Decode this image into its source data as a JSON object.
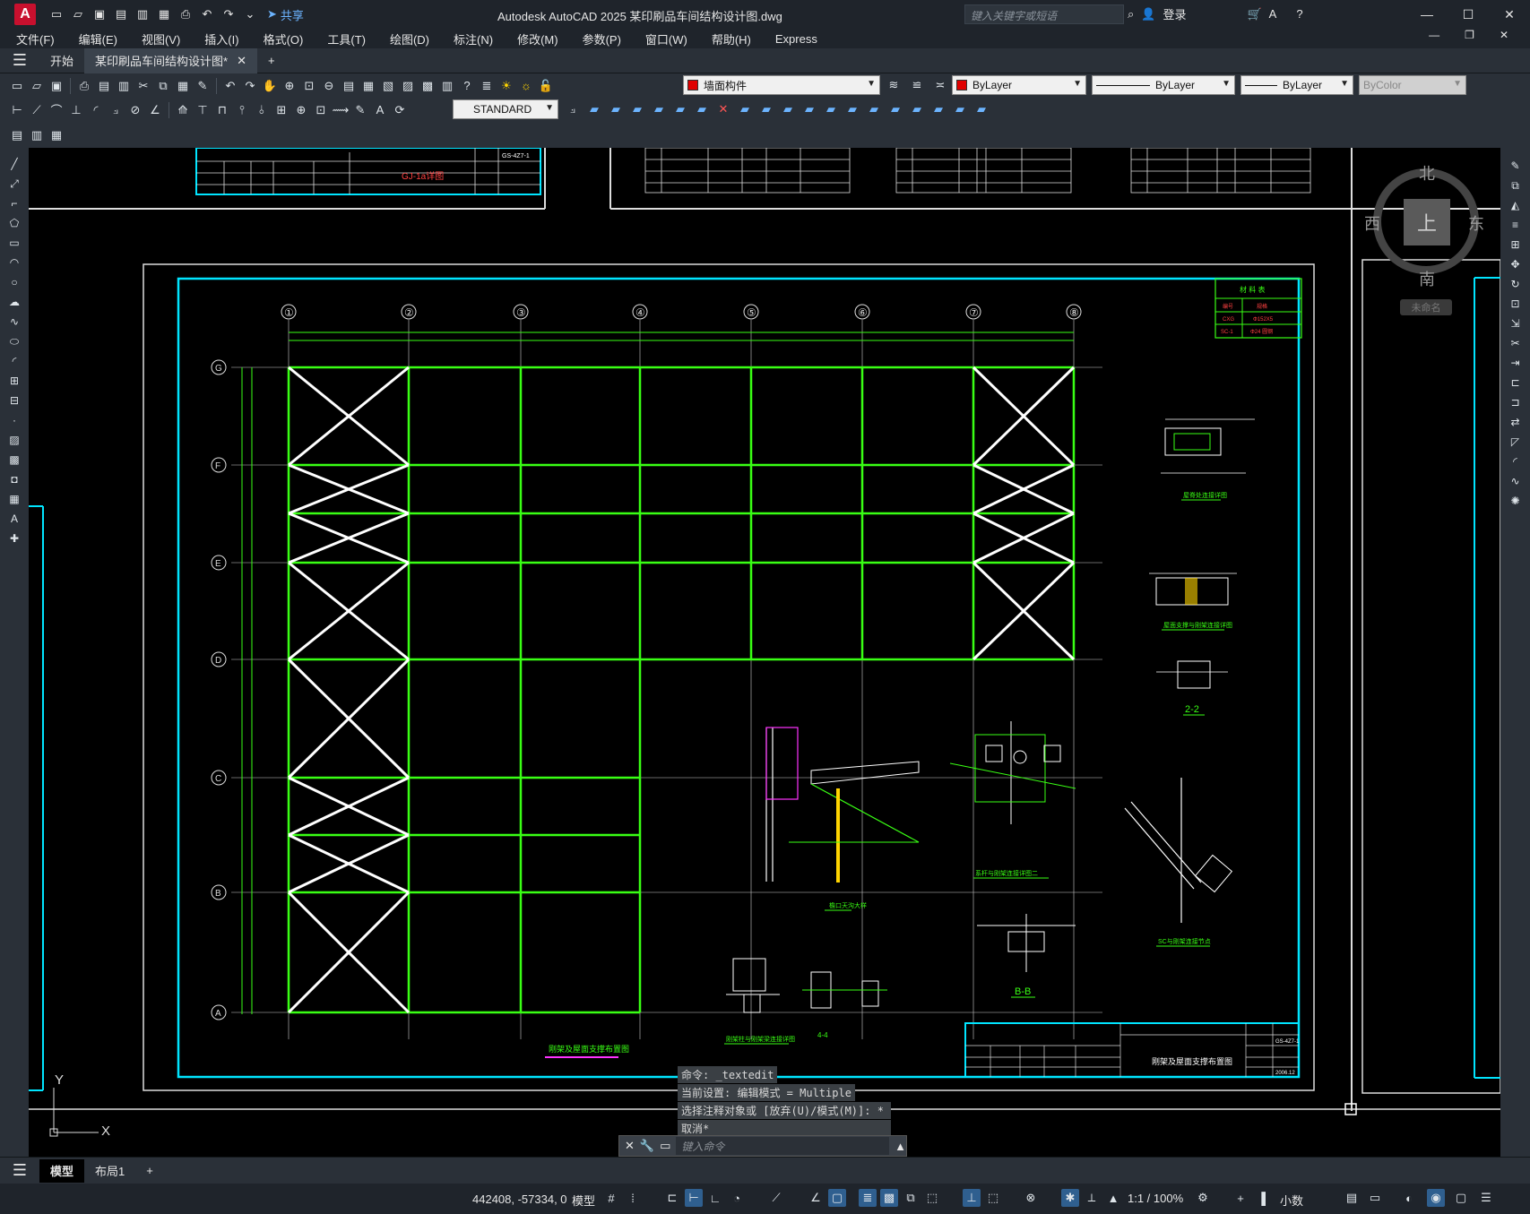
{
  "titlebar": {
    "app_letter": "A",
    "share_label": "共享",
    "title": "Autodesk AutoCAD 2025    某印刷品车间结构设计图.dwg",
    "search_placeholder": "键入关键字或短语",
    "login_label": "登录"
  },
  "menubar": {
    "items": [
      "文件(F)",
      "编辑(E)",
      "视图(V)",
      "插入(I)",
      "格式(O)",
      "工具(T)",
      "绘图(D)",
      "标注(N)",
      "修改(M)",
      "参数(P)",
      "窗口(W)",
      "帮助(H)",
      "Express"
    ]
  },
  "tabs": {
    "start": "开始",
    "file": "某印刷品车间结构设计图*"
  },
  "toolbar": {
    "layer_name": "墙面构件",
    "color": "ByLayer",
    "linetype": "ByLayer",
    "lineweight": "ByLayer",
    "plotstyle": "ByColor",
    "text_style": "STANDARD"
  },
  "viewcube": {
    "north": "北",
    "south": "南",
    "east": "东",
    "west": "西",
    "face": "上",
    "wcs": "未命名"
  },
  "command": {
    "history": [
      "命令: _textedit",
      "当前设置: 编辑模式 = Multiple",
      "选择注释对象或 [放弃(U)/模式(M)]: *",
      "取消*"
    ],
    "placeholder": "键入命令"
  },
  "drawing": {
    "main_title": "刚架及屋面支撑布置图",
    "title_block_name": "刚架及屋面支撑布置图",
    "title_block_no": "GS-4Z7-1",
    "title_block_date": "2006.12",
    "top_block_name": "GJ-1a详图",
    "top_block_no": "GS-4Z7-1",
    "material_table_title": "材 料 表",
    "material_rows": [
      [
        "编号",
        "规格"
      ],
      [
        "CXG",
        "Φ152X5"
      ],
      [
        "SC-1",
        "Φ24 圆钢"
      ]
    ],
    "column_labels": [
      "①",
      "②",
      "③",
      "④",
      "⑤",
      "⑥",
      "⑦",
      "⑧"
    ],
    "row_labels": [
      "G",
      "F",
      "E",
      "D",
      "C",
      "B",
      "A"
    ],
    "detail_labels": [
      "屋脊处连接详图",
      "屋面支撑与刚架连接详图",
      "2-2",
      "檐口天沟大样",
      "系杆与刚架连接详图二",
      "SC与刚架连接节点",
      "B-B",
      "刚架柱与刚架梁连接详图",
      "4-4"
    ],
    "ucs_y": "Y",
    "ucs_x": "X"
  },
  "layout_tabs": {
    "model": "模型",
    "layout1": "布局1"
  },
  "statusbar": {
    "coords": "442408, -57334, 0",
    "model": "模型",
    "scale": "1:1 / 100%",
    "units": "小数"
  },
  "colors": {
    "frame_green": "#39ff14",
    "brace_white": "#ffffff",
    "border_cyan": "#00e5ff",
    "accent_blue": "#2f5f8f"
  }
}
